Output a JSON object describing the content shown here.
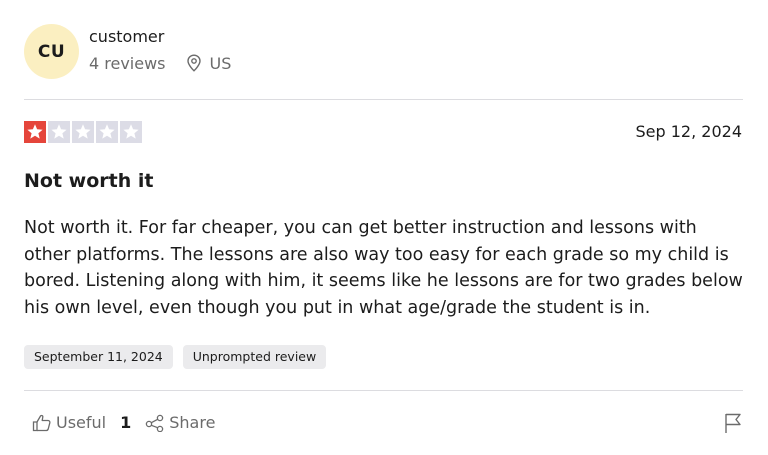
{
  "reviewer": {
    "initials": "CU",
    "name": "customer",
    "review_count": "4 reviews",
    "location": "US"
  },
  "rating": {
    "value": 1,
    "max": 5
  },
  "review": {
    "date": "Sep 12, 2024",
    "title": "Not worth it",
    "text": "Not worth it. For far cheaper, you can get better instruction and lessons with other platforms. The lessons are also way too easy for each grade so my child is bored. Listening along with him, it seems like he lessons are for two grades below his own level, even though you put in what age/grade the student is in.",
    "tags": [
      "September 11, 2024",
      "Unprompted review"
    ]
  },
  "actions": {
    "useful_label": "Useful",
    "useful_count": "1",
    "share_label": "Share"
  },
  "colors": {
    "star_filled": "#e5453b",
    "star_empty": "#dcdce6",
    "avatar_bg": "#fbefc1"
  },
  "icons": [
    "location-pin-icon",
    "star-icon",
    "thumbs-up-icon",
    "share-icon",
    "flag-icon"
  ]
}
